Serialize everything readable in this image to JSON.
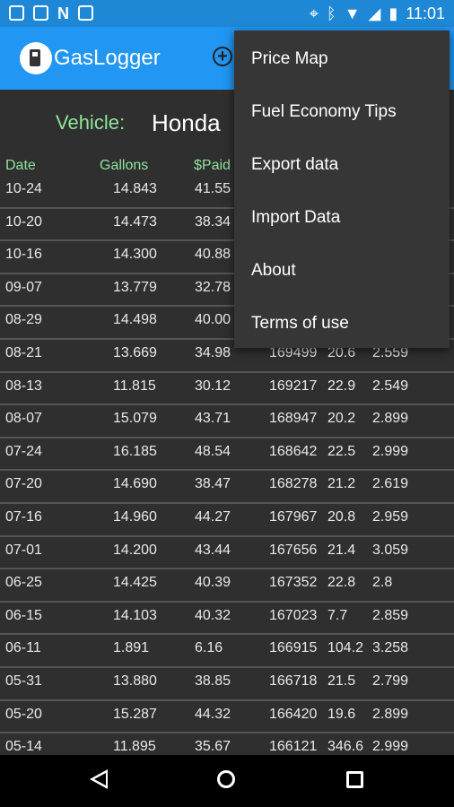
{
  "status_bar": {
    "time": "11:01",
    "left_icons": [
      "message-icon",
      "image-icon",
      "n-icon",
      "photo-icon"
    ],
    "right_icons": [
      "location-icon",
      "bluetooth-icon",
      "wifi-icon",
      "signal-icon",
      "battery-icon"
    ]
  },
  "app_bar": {
    "title": "GasLogger",
    "add_icon": "plus-circle-icon"
  },
  "vehicle": {
    "label": "Vehicle:",
    "value": "Honda"
  },
  "table": {
    "headers": {
      "date": "Date",
      "gallons": "Gallons",
      "paid": "$Paid"
    },
    "rows": [
      {
        "date": "10-24",
        "gallons": "14.843",
        "paid": "41.55",
        "odometer": "",
        "mpg": "",
        "ppg": ""
      },
      {
        "date": "10-20",
        "gallons": "14.473",
        "paid": "38.34",
        "odometer": "",
        "mpg": "",
        "ppg": ""
      },
      {
        "date": "10-16",
        "gallons": "14.300",
        "paid": "40.88",
        "odometer": "",
        "mpg": "",
        "ppg": ""
      },
      {
        "date": "09-07",
        "gallons": "13.779",
        "paid": "32.78",
        "odometer": "",
        "mpg": "",
        "ppg": ""
      },
      {
        "date": "08-29",
        "gallons": "14.498",
        "paid": "40.00",
        "odometer": "",
        "mpg": "",
        "ppg": ""
      },
      {
        "date": "08-21",
        "gallons": "13.669",
        "paid": "34.98",
        "odometer": "169499",
        "mpg": "20.6",
        "ppg": "2.559"
      },
      {
        "date": "08-13",
        "gallons": "11.815",
        "paid": "30.12",
        "odometer": "169217",
        "mpg": "22.9",
        "ppg": "2.549"
      },
      {
        "date": "08-07",
        "gallons": "15.079",
        "paid": "43.71",
        "odometer": "168947",
        "mpg": "20.2",
        "ppg": "2.899"
      },
      {
        "date": "07-24",
        "gallons": "16.185",
        "paid": "48.54",
        "odometer": "168642",
        "mpg": "22.5",
        "ppg": "2.999"
      },
      {
        "date": "07-20",
        "gallons": "14.690",
        "paid": "38.47",
        "odometer": "168278",
        "mpg": "21.2",
        "ppg": "2.619"
      },
      {
        "date": "07-16",
        "gallons": "14.960",
        "paid": "44.27",
        "odometer": "167967",
        "mpg": "20.8",
        "ppg": "2.959"
      },
      {
        "date": "07-01",
        "gallons": "14.200",
        "paid": "43.44",
        "odometer": "167656",
        "mpg": "21.4",
        "ppg": "3.059"
      },
      {
        "date": "06-25",
        "gallons": "14.425",
        "paid": "40.39",
        "odometer": "167352",
        "mpg": "22.8",
        "ppg": "2.8"
      },
      {
        "date": "06-15",
        "gallons": "14.103",
        "paid": "40.32",
        "odometer": "167023",
        "mpg": "7.7",
        "ppg": "2.859"
      },
      {
        "date": "06-11",
        "gallons": "1.891",
        "paid": "6.16",
        "odometer": "166915",
        "mpg": "104.2",
        "ppg": "3.258"
      },
      {
        "date": "05-31",
        "gallons": "13.880",
        "paid": "38.85",
        "odometer": "166718",
        "mpg": "21.5",
        "ppg": "2.799"
      },
      {
        "date": "05-20",
        "gallons": "15.287",
        "paid": "44.32",
        "odometer": "166420",
        "mpg": "19.6",
        "ppg": "2.899"
      },
      {
        "date": "05-14",
        "gallons": "11.895",
        "paid": "35.67",
        "odometer": "166121",
        "mpg": "346.6",
        "ppg": "2.999"
      }
    ]
  },
  "overflow_menu": {
    "items": [
      "Price Map",
      "Fuel Economy Tips",
      "Export data",
      "Import Data",
      "About",
      "Terms of use"
    ]
  },
  "nav_bar": {
    "icons": [
      "back-icon",
      "home-icon",
      "recents-icon"
    ]
  },
  "colors": {
    "status_bar": "#1e88d6",
    "app_bar": "#2196f3",
    "accent_green": "#8fe39c",
    "background": "#2f2f2f",
    "menu": "#363636"
  }
}
